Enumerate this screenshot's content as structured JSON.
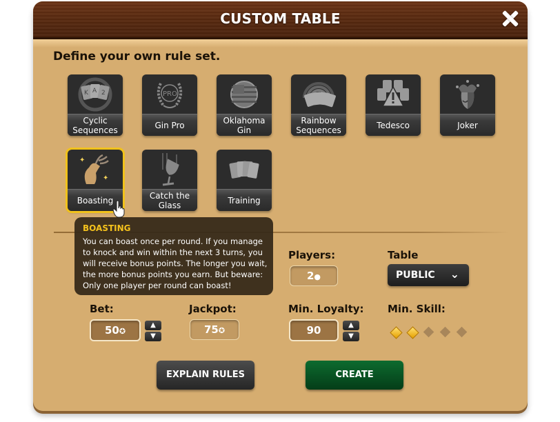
{
  "window": {
    "title": "CUSTOM TABLE",
    "close_icon": "close-icon"
  },
  "heading": "Define your own rule set.",
  "rule_sets": [
    {
      "label": "Cyclic\nSequences",
      "icon": "cards-cycle-icon",
      "selected": false
    },
    {
      "label": "Gin Pro",
      "icon": "laurel-pro-icon",
      "selected": false
    },
    {
      "label": "Oklahoma\nGin",
      "icon": "us-flag-icon",
      "selected": false
    },
    {
      "label": "Rainbow\nSequences",
      "icon": "rainbow-cards-icon",
      "selected": false
    },
    {
      "label": "Tedesco",
      "icon": "aces-warning-icon",
      "selected": false
    },
    {
      "label": "Joker",
      "icon": "jester-icon",
      "selected": false
    },
    {
      "label": "Boasting",
      "icon": "stag-icon",
      "selected": true
    },
    {
      "label": "Catch the\nGlass",
      "icon": "falling-glass-icon",
      "selected": false
    },
    {
      "label": "Training",
      "icon": "card-fan-icon",
      "selected": false
    }
  ],
  "tooltip": {
    "title": "BOASTING",
    "body": "You can boast once per round. If you manage to knock and win within the next 3 turns, you will receive bonus points. The longer you wait, the more bonus points you earn. But beware: Only one player per round can boast!"
  },
  "settings": {
    "players": {
      "label": "Players:",
      "value": "2"
    },
    "table": {
      "label": "Table",
      "selected": "PUBLIC"
    },
    "bet": {
      "label": "Bet:",
      "value": "50"
    },
    "jackpot": {
      "label": "Jackpot:",
      "value": "75"
    },
    "min_loyalty": {
      "label": "Min. Loyalty:",
      "value": "90"
    },
    "min_skill": {
      "label": "Min. Skill:",
      "level": 2,
      "max": 5
    }
  },
  "buttons": {
    "explain": "EXPLAIN RULES",
    "create": "CREATE"
  },
  "colors": {
    "panel": "#d6ad70",
    "selected_outline": "#f1c21b",
    "create_button": "#0d6b2f",
    "tooltip_title": "#f5c21c"
  }
}
